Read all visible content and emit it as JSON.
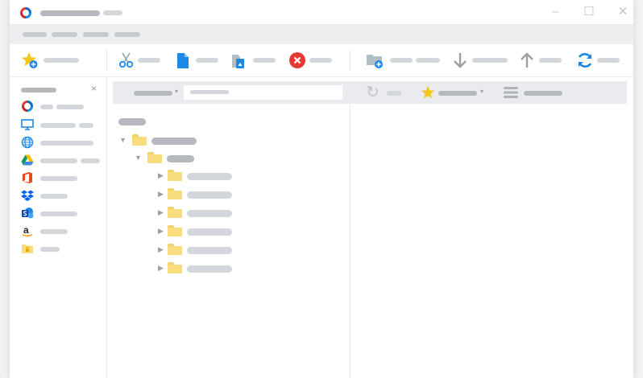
{
  "window": {
    "app_icon": "app-logo-icon",
    "controls": {
      "minimize": "–",
      "maximize": "☐",
      "close": "✕"
    }
  },
  "sidebar": {
    "close_glyph": "×"
  },
  "pathbar": {
    "refresh_glyph": "↻"
  },
  "tree": {
    "collapse_glyph": "▼",
    "expand_glyph": "▶"
  },
  "colors": {
    "folder": "#f8dc7d",
    "accent_blue": "#1e88e5",
    "star": "#f5c518",
    "delete_red": "#e53935",
    "placeholder": "#d3d6db",
    "menu_bg": "#edeef0"
  }
}
